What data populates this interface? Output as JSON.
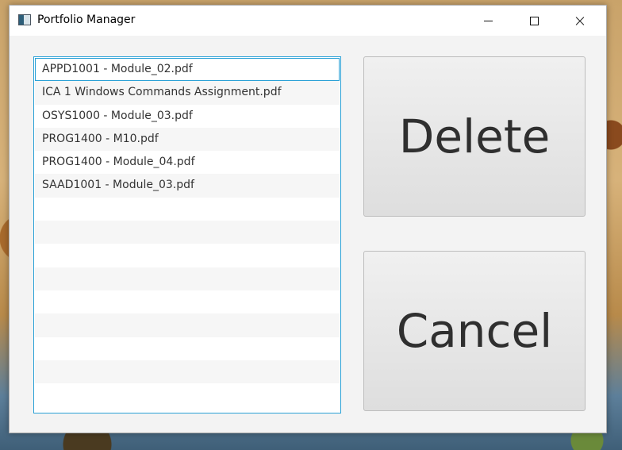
{
  "window": {
    "title": "Portfolio Manager"
  },
  "controls": {
    "icons": [
      "minimize-icon",
      "maximize-icon",
      "close-icon"
    ]
  },
  "file_list": {
    "selected_index": 0,
    "items": [
      "APPD1001 - Module_02.pdf",
      "ICA 1 Windows Commands Assignment.pdf",
      "OSYS1000 - Module_03.pdf",
      "PROG1400 - M10.pdf",
      "PROG1400 - Module_04.pdf",
      "SAAD1001 - Module_03.pdf",
      "",
      "",
      "",
      "",
      "",
      "",
      "",
      "",
      ""
    ]
  },
  "buttons": {
    "delete_label": "Delete",
    "cancel_label": "Cancel"
  },
  "colors": {
    "focus_border": "#2aa1d6",
    "window_bg": "#f3f3f3",
    "alt_row": "#f6f6f6"
  }
}
